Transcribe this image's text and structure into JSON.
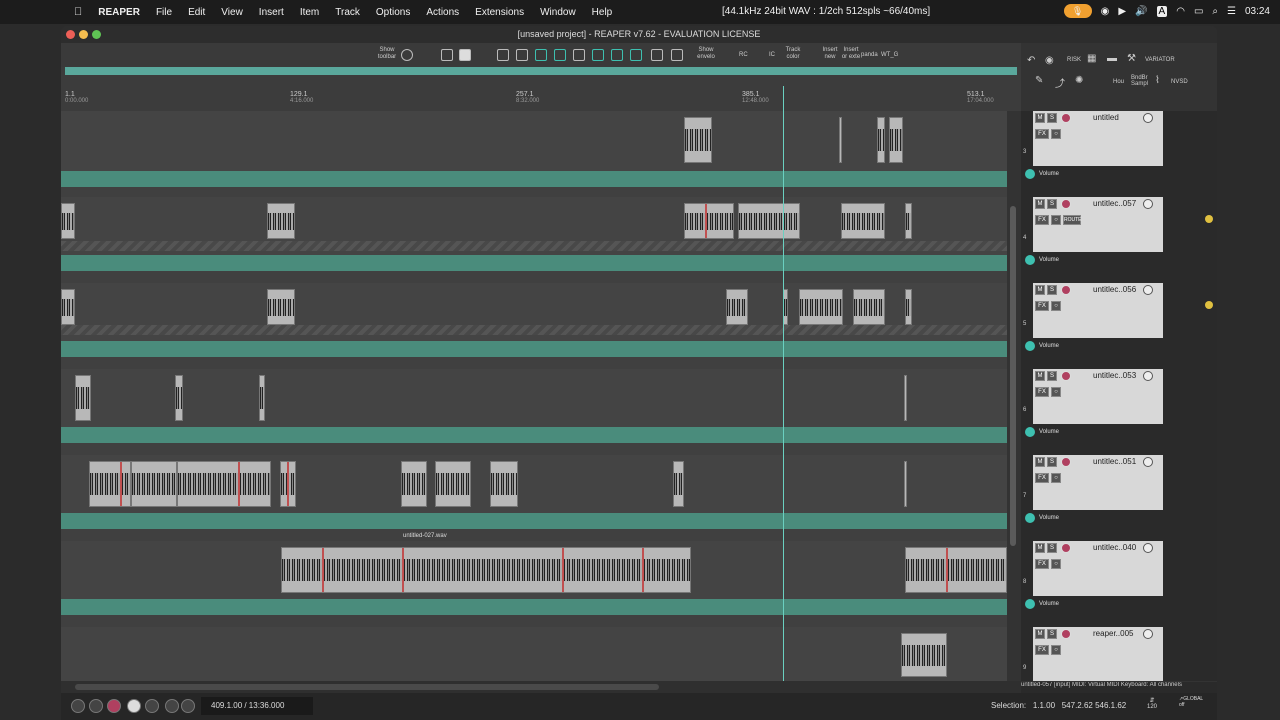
{
  "menubar": {
    "apple": "",
    "app": "REAPER",
    "items": [
      "File",
      "Edit",
      "View",
      "Insert",
      "Item",
      "Track",
      "Options",
      "Actions",
      "Extensions",
      "Window",
      "Help"
    ],
    "audio_status": "[44.1kHz 24bit WAV : 1/2ch 512spls ~66/40ms]",
    "clock": "03:24"
  },
  "window": {
    "title": "[unsaved project] - REAPER v7.62 - EVALUATION LICENSE"
  },
  "toolbar": {
    "show_toolbar": "Show toolbar",
    "show_envelope": "Show envelo",
    "rc": "RC",
    "ic": "IC",
    "track_color": "Track color",
    "insert_new": "Insert new",
    "insert_ext": "Insert or exte",
    "panda": "panda",
    "wt_g": "WT_G"
  },
  "rightpanel": {
    "risk": "RISK",
    "variator": "VARIATOR",
    "hou": "Hou",
    "bndbr": "BndBr Sampl",
    "nvsd": "NVSD"
  },
  "ruler": [
    {
      "bar": "1.1",
      "time": "0:00.000"
    },
    {
      "bar": "129.1",
      "time": "4:16.000"
    },
    {
      "bar": "257.1",
      "time": "8:32.000"
    },
    {
      "bar": "385.1",
      "time": "12:48.000"
    },
    {
      "bar": "513.1",
      "time": "17:04.000"
    }
  ],
  "items": {
    "wav1": "untitled-027.wav"
  },
  "tracks": [
    {
      "num": "3",
      "name": "untitled",
      "vol": "Volume"
    },
    {
      "num": "4",
      "name": "untitlec..057",
      "vol": "Volume",
      "route": "ROUTE"
    },
    {
      "num": "5",
      "name": "untitlec..056",
      "vol": "Volume"
    },
    {
      "num": "6",
      "name": "untitlec..053",
      "vol": "Volume"
    },
    {
      "num": "7",
      "name": "untitlec..051",
      "vol": "Volume"
    },
    {
      "num": "8",
      "name": "untitlec..040",
      "vol": "Volume"
    },
    {
      "num": "9",
      "name": "reaper..005",
      "vol": ""
    }
  ],
  "buttons": {
    "m": "M",
    "s": "S",
    "fx": "FX",
    "io": "○"
  },
  "midi_status": "untitled-057 [input] MIDI: Virtual MIDI Keyboard: All channels",
  "transport": {
    "position": "409.1.00 / 13:36.000",
    "selection_label": "Selection:",
    "selection_start": "1.1.00",
    "selection_end": "547.2.62",
    "selection_len": "546.1.62",
    "bpm": "120",
    "global": "GLOBAL",
    "off": "off"
  }
}
